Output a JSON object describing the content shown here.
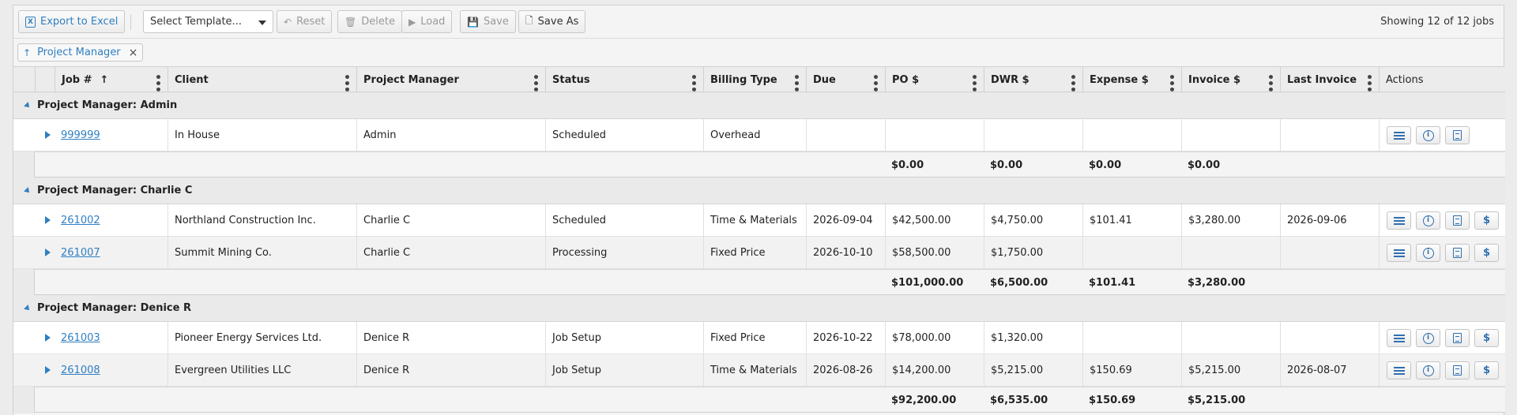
{
  "toolbar": {
    "export_label": "Export to Excel",
    "template_select": "Select Template...",
    "reset_label": "Reset",
    "delete_label": "Delete",
    "load_label": "Load",
    "save_label": "Save",
    "save_as_label": "Save As",
    "showing": "Showing 12 of 12 jobs"
  },
  "group_chip": {
    "label": "Project Manager",
    "close": "×",
    "arrow": "↑"
  },
  "columns": {
    "job": "Job #",
    "client": "Client",
    "pm": "Project Manager",
    "status": "Status",
    "billing": "Billing Type",
    "due": "Due",
    "po": "PO $",
    "dwr": "DWR $",
    "expense": "Expense $",
    "invoice": "Invoice $",
    "last_invoice": "Last Invoice",
    "actions": "Actions"
  },
  "groups": [
    {
      "title": "Project Manager: Admin",
      "rows": [
        {
          "job": "999999",
          "client": "In House",
          "pm": "Admin",
          "status": "Scheduled",
          "billing": "Overhead",
          "due": "",
          "po": "",
          "dwr": "",
          "expense": "",
          "invoice": "",
          "last_invoice": "",
          "has_invoice_action": false
        }
      ],
      "totals": {
        "po": "$0.00",
        "dwr": "$0.00",
        "expense": "$0.00",
        "invoice": "$0.00"
      }
    },
    {
      "title": "Project Manager: Charlie C",
      "rows": [
        {
          "job": "261002",
          "client": "Northland Construction Inc.",
          "pm": "Charlie C",
          "status": "Scheduled",
          "billing": "Time & Materials",
          "due": "2026-09-04",
          "po": "$42,500.00",
          "dwr": "$4,750.00",
          "expense": "$101.41",
          "invoice": "$3,280.00",
          "last_invoice": "2026-09-06",
          "has_invoice_action": true
        },
        {
          "job": "261007",
          "client": "Summit Mining Co.",
          "pm": "Charlie C",
          "status": "Processing",
          "billing": "Fixed Price",
          "due": "2026-10-10",
          "po": "$58,500.00",
          "dwr": "$1,750.00",
          "expense": "",
          "invoice": "",
          "last_invoice": "",
          "has_invoice_action": true
        }
      ],
      "totals": {
        "po": "$101,000.00",
        "dwr": "$6,500.00",
        "expense": "$101.41",
        "invoice": "$3,280.00"
      }
    },
    {
      "title": "Project Manager: Denice R",
      "rows": [
        {
          "job": "261003",
          "client": "Pioneer Energy Services Ltd.",
          "pm": "Denice R",
          "status": "Job Setup",
          "billing": "Fixed Price",
          "due": "2026-10-22",
          "po": "$78,000.00",
          "dwr": "$1,320.00",
          "expense": "",
          "invoice": "",
          "last_invoice": "",
          "has_invoice_action": true
        },
        {
          "job": "261008",
          "client": "Evergreen Utilities LLC",
          "pm": "Denice R",
          "status": "Job Setup",
          "billing": "Time & Materials",
          "due": "2026-08-26",
          "po": "$14,200.00",
          "dwr": "$5,215.00",
          "expense": "$150.69",
          "invoice": "$5,215.00",
          "last_invoice": "2026-08-07",
          "has_invoice_action": true
        }
      ],
      "totals": {
        "po": "$92,200.00",
        "dwr": "$6,535.00",
        "expense": "$150.69",
        "invoice": "$5,215.00"
      }
    }
  ],
  "icons": {
    "details": "list-icon",
    "info": "info-icon",
    "document": "document-icon",
    "invoice": "dollar-icon"
  },
  "colors": {
    "accent": "#2f7fc1"
  }
}
